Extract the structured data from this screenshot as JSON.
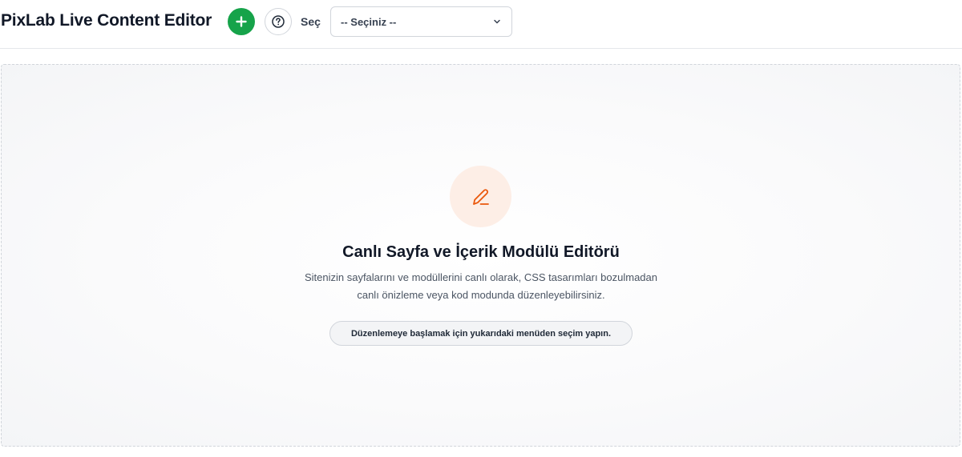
{
  "header": {
    "title": "PixLab Live Content Editor",
    "add_icon": "plus-icon",
    "help_icon": "question-circle-icon",
    "select_label": "Seç",
    "select_value": "-- Seçiniz --",
    "select_icon": "chevron-down-icon"
  },
  "empty_state": {
    "icon": "pencil-icon",
    "title": "Canlı Sayfa ve İçerik Modülü Editörü",
    "description_line1": "Sitenizin sayfalarını ve modüllerini canlı olarak, CSS tasarımları bozulmadan",
    "description_line2": "canlı önizleme veya kod modunda düzenleyebilirsiniz.",
    "hint": "Düzenlemeye başlamak için yukarıdaki menüden seçim yapın."
  },
  "colors": {
    "accent_green": "#16a34a",
    "icon_orange": "#ea580c",
    "icon_bg": "#fdeee6"
  }
}
